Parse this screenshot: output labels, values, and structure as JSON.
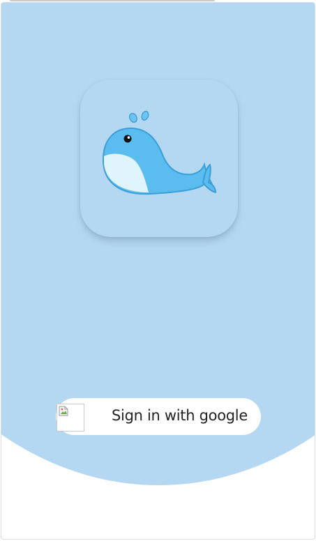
{
  "signin": {
    "label": "Sign in with google"
  },
  "logo": {
    "icon": "whale-icon"
  },
  "colors": {
    "background_blue": "#b5d8f2",
    "whale_body": "#5bbcef",
    "whale_belly": "#dff4fb",
    "button_bg": "#ffffff",
    "button_text": "#222222"
  }
}
